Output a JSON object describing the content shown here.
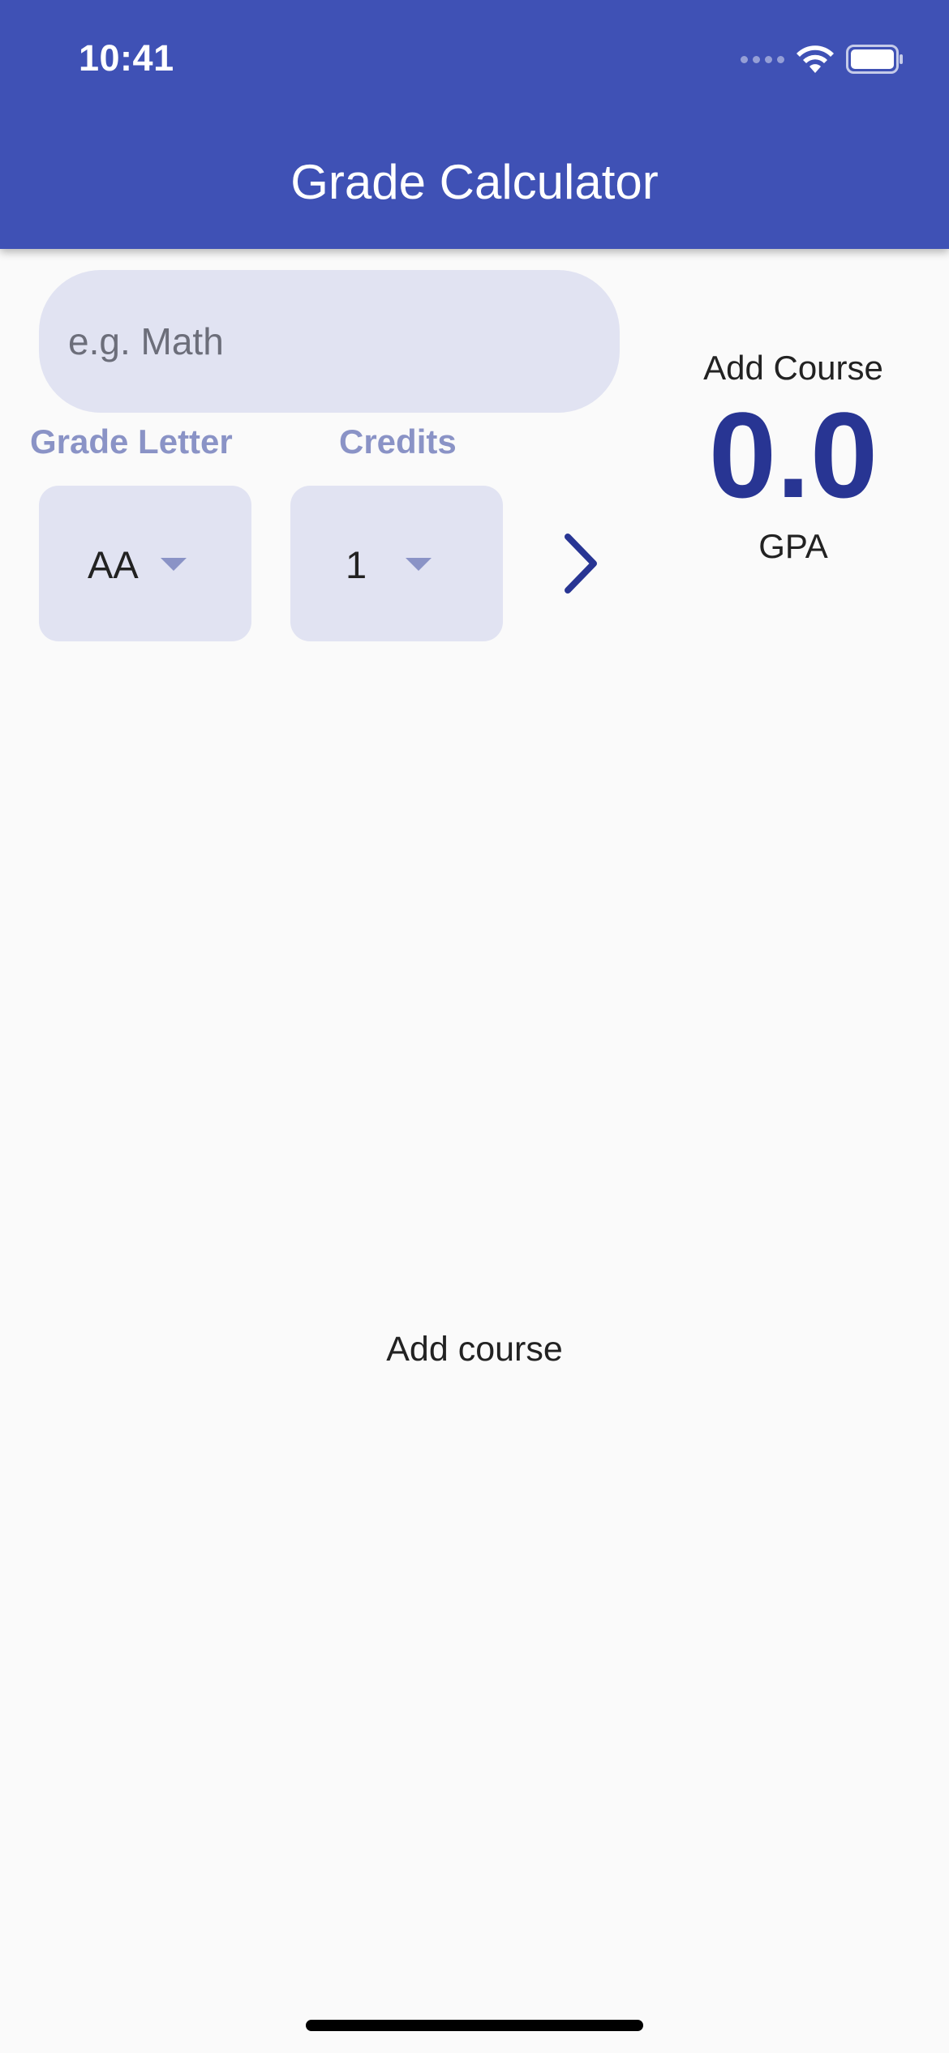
{
  "status_bar": {
    "time": "10:41"
  },
  "app_bar": {
    "title": "Grade Calculator"
  },
  "form": {
    "course_placeholder": "e.g. Math",
    "course_value": "",
    "grade_label": "Grade Letter",
    "credits_label": "Credits",
    "grade_value": "AA",
    "credits_value": "1"
  },
  "gpa": {
    "heading": "Add Course",
    "value": "0.0",
    "label": "GPA"
  },
  "empty_state": {
    "message": "Add course"
  },
  "colors": {
    "primary": "#3f51b5",
    "accent": "#283593",
    "field_bg": "#e1e3f2",
    "label": "#8a93c6"
  }
}
